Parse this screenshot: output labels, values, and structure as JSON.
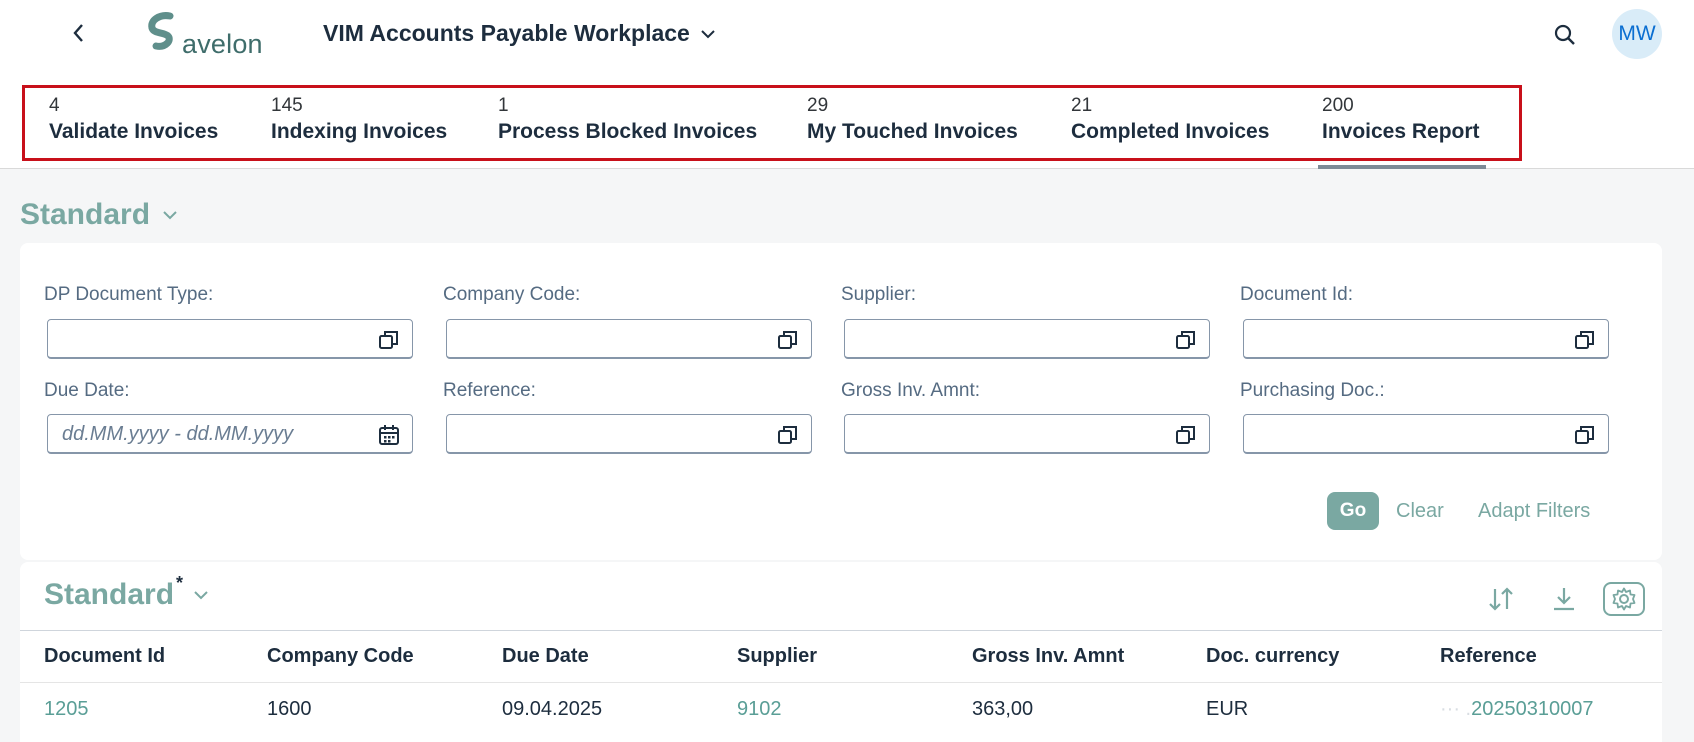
{
  "shell": {
    "logo_text": "avelon",
    "title": "VIM Accounts Payable Workplace",
    "avatar_initials": "MW"
  },
  "tiles": [
    {
      "count": "4",
      "label": "Validate Invoices"
    },
    {
      "count": "145",
      "label": "Indexing Invoices"
    },
    {
      "count": "1",
      "label": "Process Blocked Invoices"
    },
    {
      "count": "29",
      "label": "My Touched Invoices"
    },
    {
      "count": "21",
      "label": "Completed Invoices"
    },
    {
      "count": "200",
      "label": "Invoices Report",
      "selected": true
    }
  ],
  "variant": {
    "title": "Standard"
  },
  "filters": {
    "fields": [
      {
        "label": "DP Document Type:",
        "value": ""
      },
      {
        "label": "Company Code:",
        "value": ""
      },
      {
        "label": "Supplier:",
        "value": ""
      },
      {
        "label": "Document Id:",
        "value": ""
      },
      {
        "label": "Due Date:",
        "value": "",
        "placeholder": "dd.MM.yyyy - dd.MM.yyyy"
      },
      {
        "label": "Reference:",
        "value": ""
      },
      {
        "label": "Gross Inv. Amnt:",
        "value": ""
      },
      {
        "label": "Purchasing Doc.:",
        "value": ""
      }
    ],
    "go_label": "Go",
    "clear_label": "Clear",
    "adapt_label": "Adapt Filters"
  },
  "table": {
    "title": "Standard",
    "modified_marker": "*",
    "columns": [
      "Document Id",
      "Company Code",
      "Due Date",
      "Supplier",
      "Gross Inv. Amnt",
      "Doc. currency",
      "Reference"
    ],
    "rows": [
      {
        "document_id": "1205",
        "company_code": "1600",
        "due_date": "09.04.2025",
        "supplier": "9102",
        "gross_amount": "363,00",
        "currency": "EUR",
        "reference_masked": "··· .",
        "reference": "20250310007"
      }
    ]
  },
  "colors": {
    "accent": "#7aa8a2",
    "highlight_frame": "#c8101a",
    "link": "#5a9e96"
  }
}
